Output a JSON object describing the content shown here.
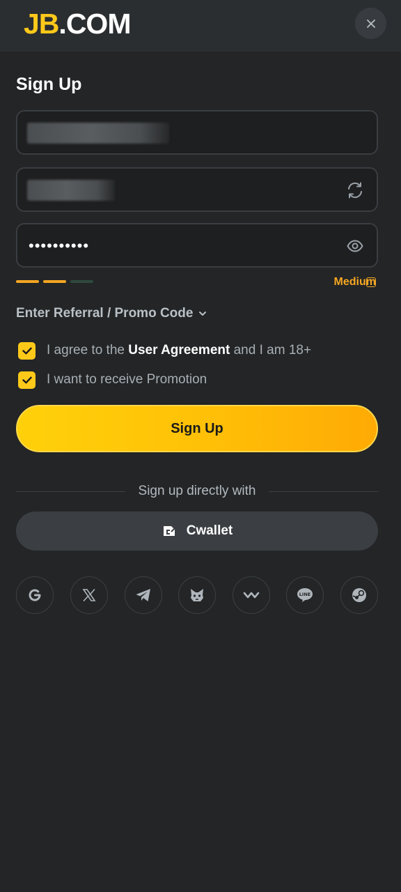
{
  "header": {
    "logo_part1": "JB",
    "logo_part2": ".COM",
    "close_icon": "close-icon"
  },
  "form": {
    "title": "Sign Up",
    "password_value": "••••••••••",
    "refresh_icon": "refresh-icon",
    "eye_icon": "eye-icon",
    "strength": {
      "level": 2,
      "of": 3,
      "label": "Medium",
      "info_icon": "i"
    },
    "referral_label": "Enter Referral / Promo Code",
    "agreement": {
      "prefix": "I agree to the ",
      "link": "User Agreement",
      "suffix": " and I am 18+",
      "checked": true
    },
    "promotion": {
      "label": "I want to receive Promotion",
      "checked": true
    },
    "submit_label": "Sign Up"
  },
  "social_section": {
    "divider_text": "Sign up directly with",
    "cwallet_label": "Cwallet",
    "providers": [
      "google",
      "x",
      "telegram",
      "metamask",
      "walletconnect",
      "line",
      "steam"
    ]
  },
  "colors": {
    "background": "#232526",
    "accent": "#ffc91a",
    "strength_active": "#f5a623",
    "strength_inactive": "#2f4a3f"
  }
}
